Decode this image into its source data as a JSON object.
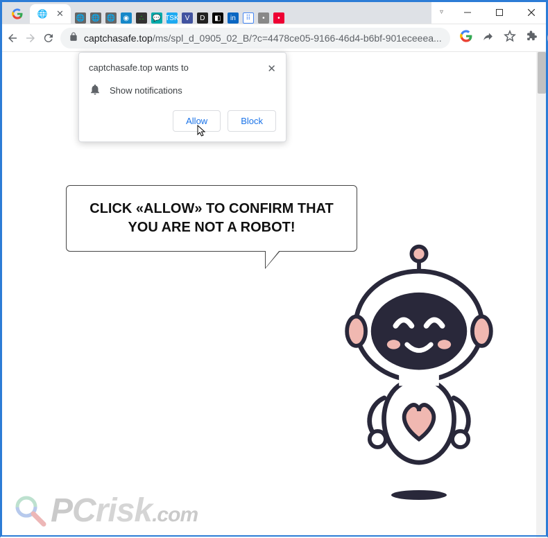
{
  "window": {
    "minimize": "—",
    "maximize": "☐",
    "close": "✕"
  },
  "tabs": {
    "active_title": "",
    "close_glyph": "✕"
  },
  "addressbar": {
    "domain": "captchasafe.top",
    "path": "/ms/spl_d_0905_02_B/?c=4478ce05-9166-46d4-b6bf-901eceeea..."
  },
  "permission": {
    "origin": "captchasafe.top wants to",
    "row1": "Show notifications",
    "allow": "Allow",
    "block": "Block",
    "close": "✕"
  },
  "bubble": {
    "text": "CLICK «ALLOW» TO CONFIRM THAT YOU ARE NOT A ROBOT!"
  },
  "watermark": {
    "brand_p": "P",
    "brand_c": "C",
    "brand_rest": "risk",
    "brand_tld": ".com"
  },
  "colors": {
    "link_blue": "#1a73e8",
    "frame_blue": "#2c7cd6",
    "robot_dark": "#29283a",
    "robot_pink": "#f0b8b1"
  }
}
